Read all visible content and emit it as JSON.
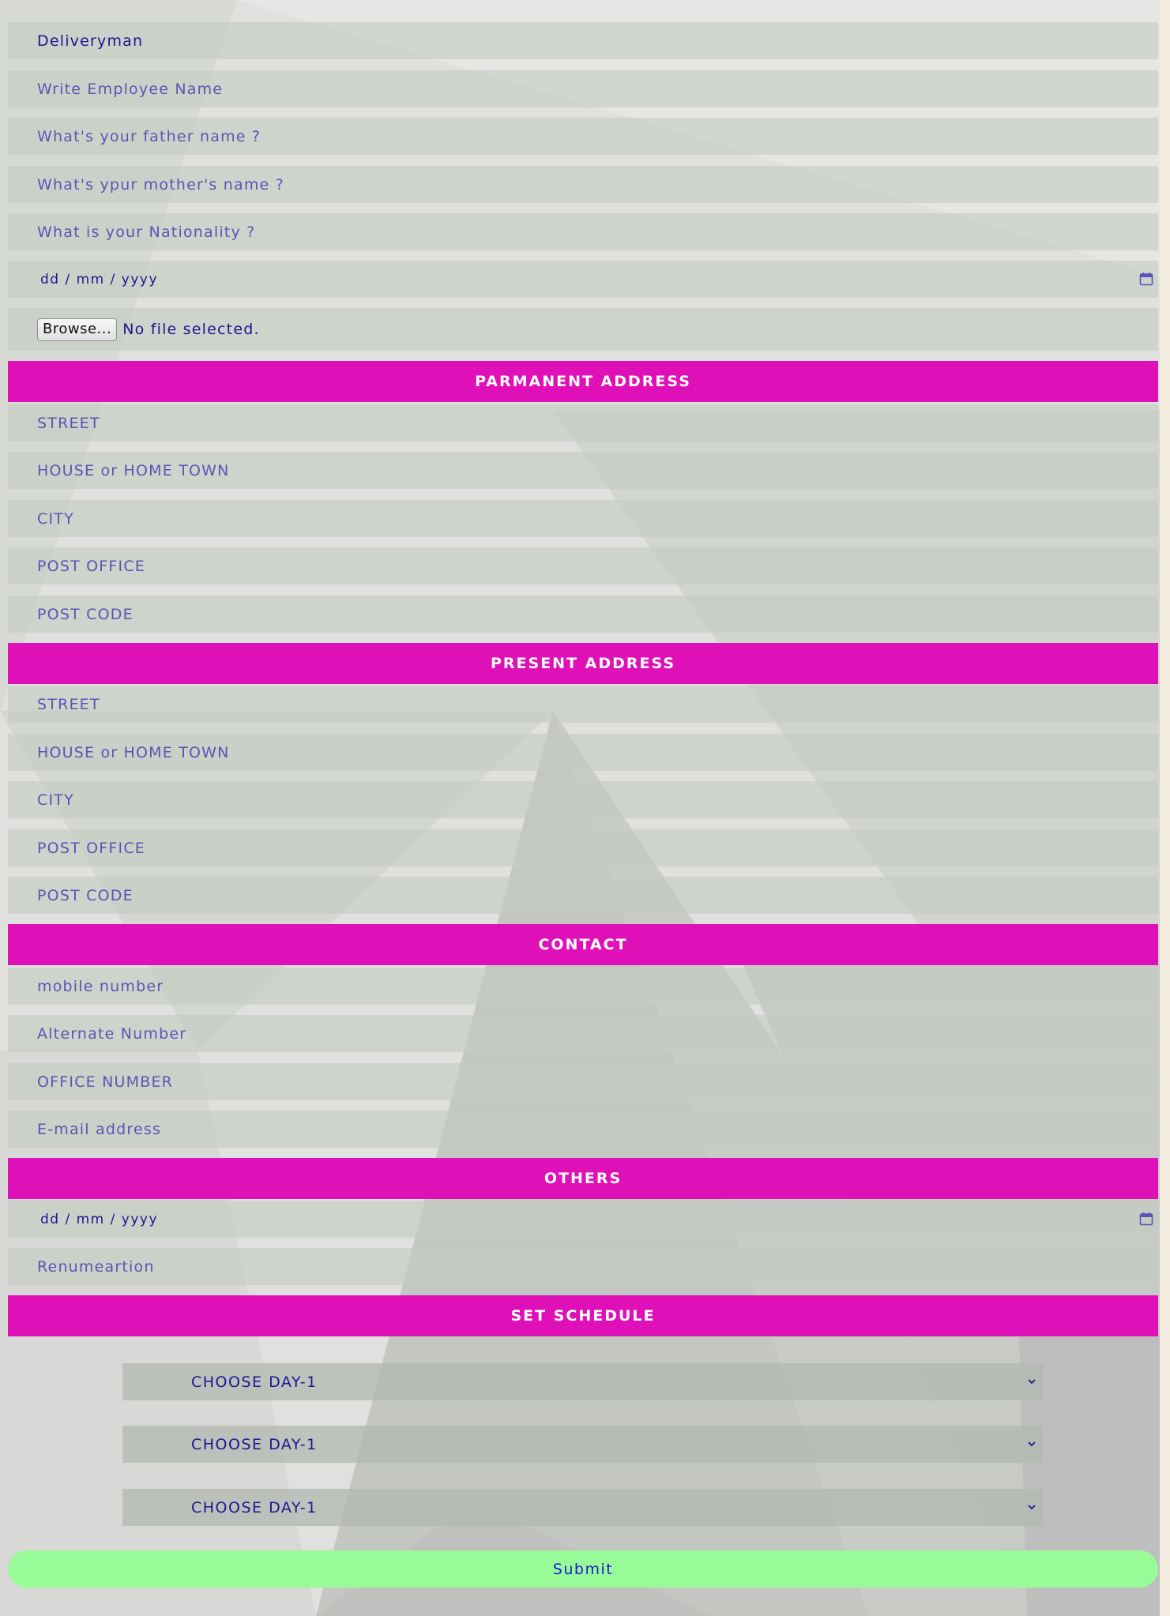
{
  "form": {
    "designation_value": "Deliveryman",
    "employee_name_placeholder": "Write Employee Name",
    "father_name_placeholder": "What's your father name ?",
    "mother_name_placeholder": "What's ypur mother's name ?",
    "nationality_placeholder": "What is your Nationality ?",
    "birth_date_placeholder": "dd / mm / yyyy",
    "browse_label": "Browse...",
    "file_status": "No file selected."
  },
  "permanent_address": {
    "title": "PARMANENT ADDRESS",
    "street": "STREET",
    "house": "HOUSE or HOME TOWN",
    "city": "CITY",
    "post_office": "POST OFFICE",
    "post_code": "POST CODE"
  },
  "present_address": {
    "title": "PRESENT ADDRESS",
    "street": "STREET",
    "house": "HOUSE or HOME TOWN",
    "city": "CITY",
    "post_office": "POST OFFICE",
    "post_code": "POST CODE"
  },
  "contact": {
    "title": "CONTACT",
    "mobile": "mobile number",
    "alternate": "Alternate Number",
    "office": "OFFICE NUMBER",
    "email": "E-mail address"
  },
  "others": {
    "title": "OTHERS",
    "date_placeholder": "dd / mm / yyyy",
    "remuneration": "Renumeartion"
  },
  "schedule": {
    "title": "SET SCHEDULE",
    "selects": [
      "CHOOSE DAY-1",
      "CHOOSE DAY-1",
      "CHOOSE DAY-1"
    ]
  },
  "submit_label": "Submit",
  "colors": {
    "section_header": "#e010b8",
    "submit_bg": "#98fb98",
    "field_text": "#1b1690",
    "placeholder_text": "#5a55b4"
  },
  "icons": {
    "date_picker": "calendar-icon",
    "select_arrow": "chevron-down-icon"
  }
}
